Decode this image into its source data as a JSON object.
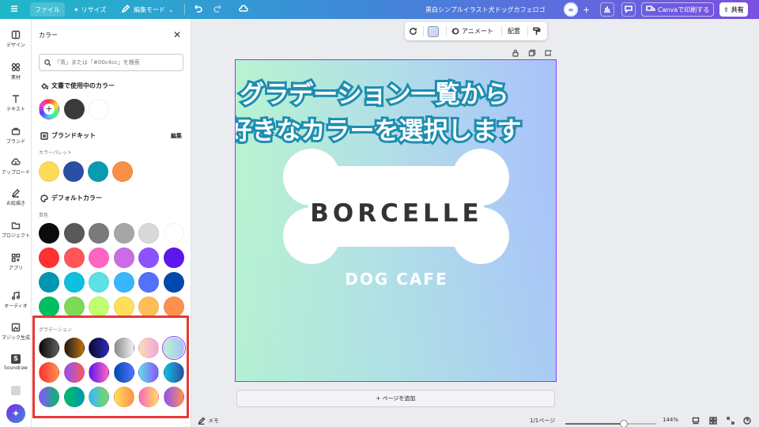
{
  "topbar": {
    "menu_icon": "hamburger-icon",
    "file_label": "ファイル",
    "resize_label": "リサイズ",
    "edit_mode_label": "編集モード",
    "doc_title": "黒白シンプルイラスト犬ドッグカフェロゴ",
    "print_label": "Canvaで印刷する",
    "share_label": "共有",
    "brand_color": "#7d2ae8"
  },
  "rail": {
    "items": [
      {
        "label": "デザイン",
        "icon": "layout-icon"
      },
      {
        "label": "素材",
        "icon": "shapes-icon"
      },
      {
        "label": "テキスト",
        "icon": "text-icon"
      },
      {
        "label": "ブランド",
        "icon": "brand-icon"
      },
      {
        "label": "アップロード",
        "icon": "cloud-upload-icon"
      },
      {
        "label": "お絵描き",
        "icon": "draw-icon"
      },
      {
        "label": "プロジェクト",
        "icon": "folder-icon"
      },
      {
        "label": "アプリ",
        "icon": "apps-icon"
      },
      {
        "label": "オーディオ",
        "icon": "music-icon"
      },
      {
        "label": "マジック生成",
        "icon": "magic-media-icon"
      },
      {
        "label": "Soundraw",
        "icon": "soundraw-icon"
      }
    ]
  },
  "panel": {
    "title": "カラー",
    "search_placeholder": "「青」または「#00c4cc」を検索",
    "doc_colors_title": "文書で使用中のカラー",
    "doc_colors": [
      "#3a3a3a",
      "#ffffff"
    ],
    "brand_kit_title": "ブランドキット",
    "brand_kit_edit": "編集",
    "palette_label": "カラーパレット",
    "palette": [
      "#fddb5a",
      "#2b4fa4",
      "#0b9bb0",
      "#fb8f45"
    ],
    "default_title": "デフォルトカラー",
    "solid_label": "単色",
    "solid_colors": [
      [
        "#0b0b0b",
        "#595959",
        "#7a7a7a",
        "#a6a6a6",
        "#d9d9d9",
        "#ffffff"
      ],
      [
        "#ff3131",
        "#ff5757",
        "#ff66c4",
        "#cb6ce6",
        "#8c52ff",
        "#5e17eb"
      ],
      [
        "#0097b2",
        "#0cc0df",
        "#5ce1e6",
        "#38b6ff",
        "#5271ff",
        "#004aad"
      ],
      [
        "#00bf63",
        "#7ed957",
        "#c1ff72",
        "#ffde59",
        "#ffbd59",
        "#ff914d"
      ]
    ],
    "gradient_label": "グラデーション",
    "gradients": [
      [
        "linear-gradient(90deg,#0b0b0b,#5e5e5e)",
        "linear-gradient(90deg,#1c1c1c,#c1720b)",
        "linear-gradient(90deg,#0b0b2e,#2d2bb8)",
        "linear-gradient(90deg,#8a8a8a,#f1f1f1)",
        "linear-gradient(90deg,#fddcb5,#f0a6e0)",
        "linear-gradient(90deg,#b8f3d1,#a9c2fb)"
      ],
      [
        "linear-gradient(90deg,#ff3131,#ff914d)",
        "linear-gradient(90deg,#8c52ff,#ff5757)",
        "linear-gradient(90deg,#5e17eb,#ff66c4)",
        "linear-gradient(90deg,#004aad,#5271ff)",
        "linear-gradient(90deg,#5ce1e6,#8c52ff)",
        "linear-gradient(90deg,#0cc0df,#2b4fa4)"
      ],
      [
        "linear-gradient(90deg,#8c52ff,#00bf63)",
        "linear-gradient(90deg,#00bf63,#0097b2)",
        "linear-gradient(90deg,#38b6ff,#7ed957)",
        "linear-gradient(90deg,#ffde59,#ff914d)",
        "linear-gradient(90deg,#ff66c4,#ffde59)",
        "linear-gradient(90deg,#8c52ff,#ff914d)"
      ]
    ]
  },
  "floatbar": {
    "animate_label": "アニメート",
    "arrange_label": "配置"
  },
  "design": {
    "headline_1": "グラデーション一覧から",
    "headline_2": "好きなカラーを選択します",
    "brand_name": "BORCELLE",
    "sub_name": "DOG CAFE"
  },
  "add_page_label": "+ ページを追加",
  "bottombar": {
    "notes_label": "メモ",
    "page_indicator": "1/1ページ",
    "zoom_label": "144%",
    "zoom_fraction": 0.64
  }
}
